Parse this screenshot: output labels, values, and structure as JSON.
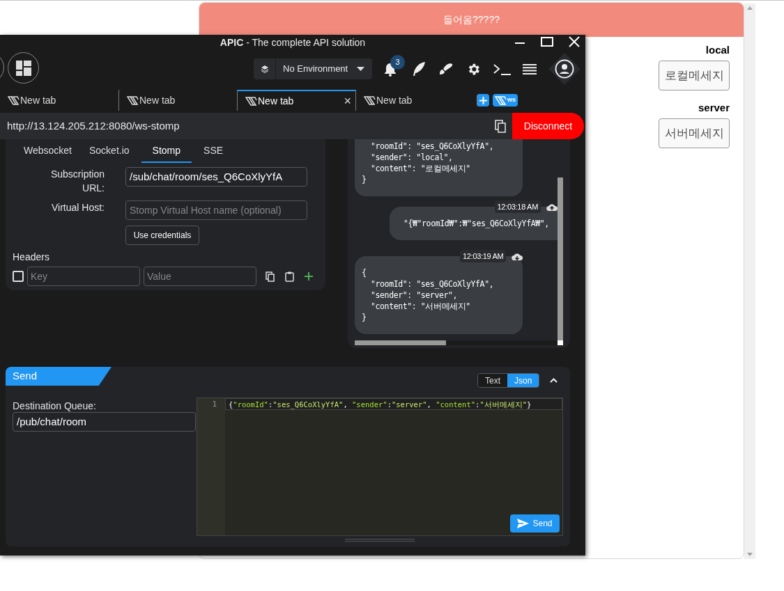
{
  "background_page": {
    "banner": "들어옴?????",
    "groups": [
      {
        "label": "local",
        "button": "로컬메세지"
      },
      {
        "label": "server",
        "button": "서버메세지"
      }
    ]
  },
  "window": {
    "title": "**APIC** - The complete API solution"
  },
  "toolbar": {
    "environment": "No Environment",
    "notification_count": "3"
  },
  "tabs": [
    {
      "label": "New tab",
      "selected": false
    },
    {
      "label": "New tab",
      "selected": false
    },
    {
      "label": "New tab",
      "selected": true,
      "close": "×"
    },
    {
      "label": "New tab",
      "selected": false
    }
  ],
  "new_ws_tab": "ws",
  "url_bar": {
    "url": "http://13.124.205.212:8080/ws-stomp",
    "button": "Disconnect"
  },
  "protocol_tabs": [
    {
      "label": "Websocket",
      "selected": false
    },
    {
      "label": "Socket.io",
      "selected": false
    },
    {
      "label": "Stomp",
      "selected": true
    },
    {
      "label": "SSE",
      "selected": false
    }
  ],
  "subscription": {
    "label": "Subscription URL:",
    "value": "/sub/chat/room/ses_Q6CoXlyYfA"
  },
  "virtual_host": {
    "label": "Virtual Host:",
    "placeholder": "Stomp Virtual Host name (optional)"
  },
  "credentials_button": "Use credentials",
  "headers": {
    "title": "Headers",
    "rows": [
      {
        "checked": false,
        "key_placeholder": "Key",
        "value_placeholder": "Value"
      }
    ]
  },
  "messages": [
    {
      "kind": "received",
      "lines": [
        "  \"roomId\": \"ses_Q6CoXlyYfA\",",
        "  \"sender\": \"local\",",
        "  \"content\": \"로컬메세지\"",
        "}"
      ]
    },
    {
      "kind": "sent",
      "time": "12:03:18 AM",
      "lines": [
        "\"{₩\"roomId₩\":₩\"ses_Q6CoXlyYfA₩\","
      ]
    },
    {
      "kind": "received",
      "time": "12:03:19 AM",
      "lines": [
        "{",
        "  \"roomId\": \"ses_Q6CoXlyYfA\",",
        "  \"sender\": \"server\",",
        "  \"content\": \"서버메세지\"",
        "}"
      ]
    }
  ],
  "send": {
    "title": "Send",
    "modes": [
      {
        "label": "Text",
        "selected": false
      },
      {
        "label": "Json",
        "selected": true
      }
    ],
    "destination_label": "Destination Queue:",
    "destination_value": "/pub/chat/room",
    "editor": {
      "line_number": "1",
      "tokens": [
        {
          "kind": "punct",
          "text": "{"
        },
        {
          "kind": "key",
          "text": "\"roomId\""
        },
        {
          "kind": "punct",
          "text": ":"
        },
        {
          "kind": "string",
          "text": "\"ses_Q6CoXlyYfA\""
        },
        {
          "kind": "punct",
          "text": ", "
        },
        {
          "kind": "key",
          "text": "\"sender\""
        },
        {
          "kind": "punct",
          "text": ":"
        },
        {
          "kind": "string",
          "text": "\"server\""
        },
        {
          "kind": "punct",
          "text": ", "
        },
        {
          "kind": "key",
          "text": "\"content\""
        },
        {
          "kind": "punct",
          "text": ":"
        },
        {
          "kind": "string",
          "text": "\"서버메세지\""
        },
        {
          "kind": "punct",
          "text": "}"
        }
      ]
    },
    "button": "Send"
  }
}
